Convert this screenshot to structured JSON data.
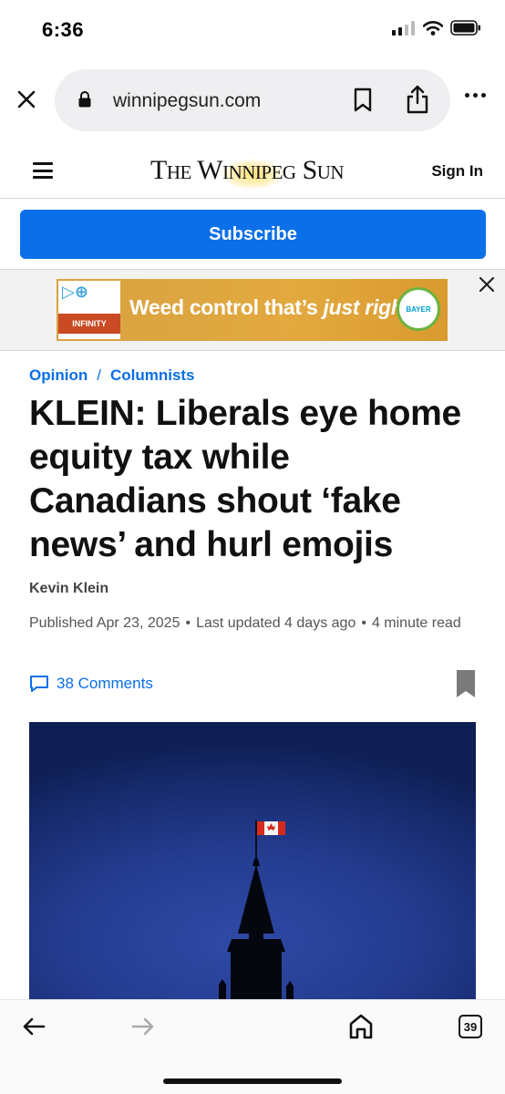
{
  "status_bar": {
    "time": "6:36",
    "icons": [
      "cellular-signal-icon",
      "wifi-icon",
      "battery-icon"
    ]
  },
  "browser": {
    "url": "winnipegsun.com",
    "icons": [
      "close-icon",
      "lock-icon",
      "bookmark-icon",
      "share-icon",
      "more-icon"
    ]
  },
  "site_header": {
    "logo_text": "The Winnipeg Sun",
    "sign_in_label": "Sign In"
  },
  "subscribe_label": "Subscribe",
  "ad": {
    "headline_plain": "Weed control that’s ",
    "headline_emphasis": "just right",
    "brand_left": "INFINITY",
    "brand_right": "BAYER"
  },
  "article": {
    "breadcrumb": {
      "section": "Opinion",
      "separator": "/",
      "subsection": "Columnists"
    },
    "headline": "KLEIN: Liberals eye home equity tax while Canadians shout ‘fake news’ and hurl emojis",
    "author": "Kevin Klein",
    "published": "Published Apr 23, 2025",
    "updated": "Last updated 4 days ago",
    "read_time": "4 minute read",
    "meta_separator": "•",
    "comments_label": "38 Comments"
  },
  "bottom_bar": {
    "tabs_count": "39",
    "icons": [
      "back-arrow-icon",
      "forward-arrow-icon",
      "home-icon",
      "tabs-icon"
    ]
  },
  "colors": {
    "accent_blue": "#0a6fe8",
    "ad_gold": "#e3a93f",
    "hero_sky": "#243c90"
  }
}
